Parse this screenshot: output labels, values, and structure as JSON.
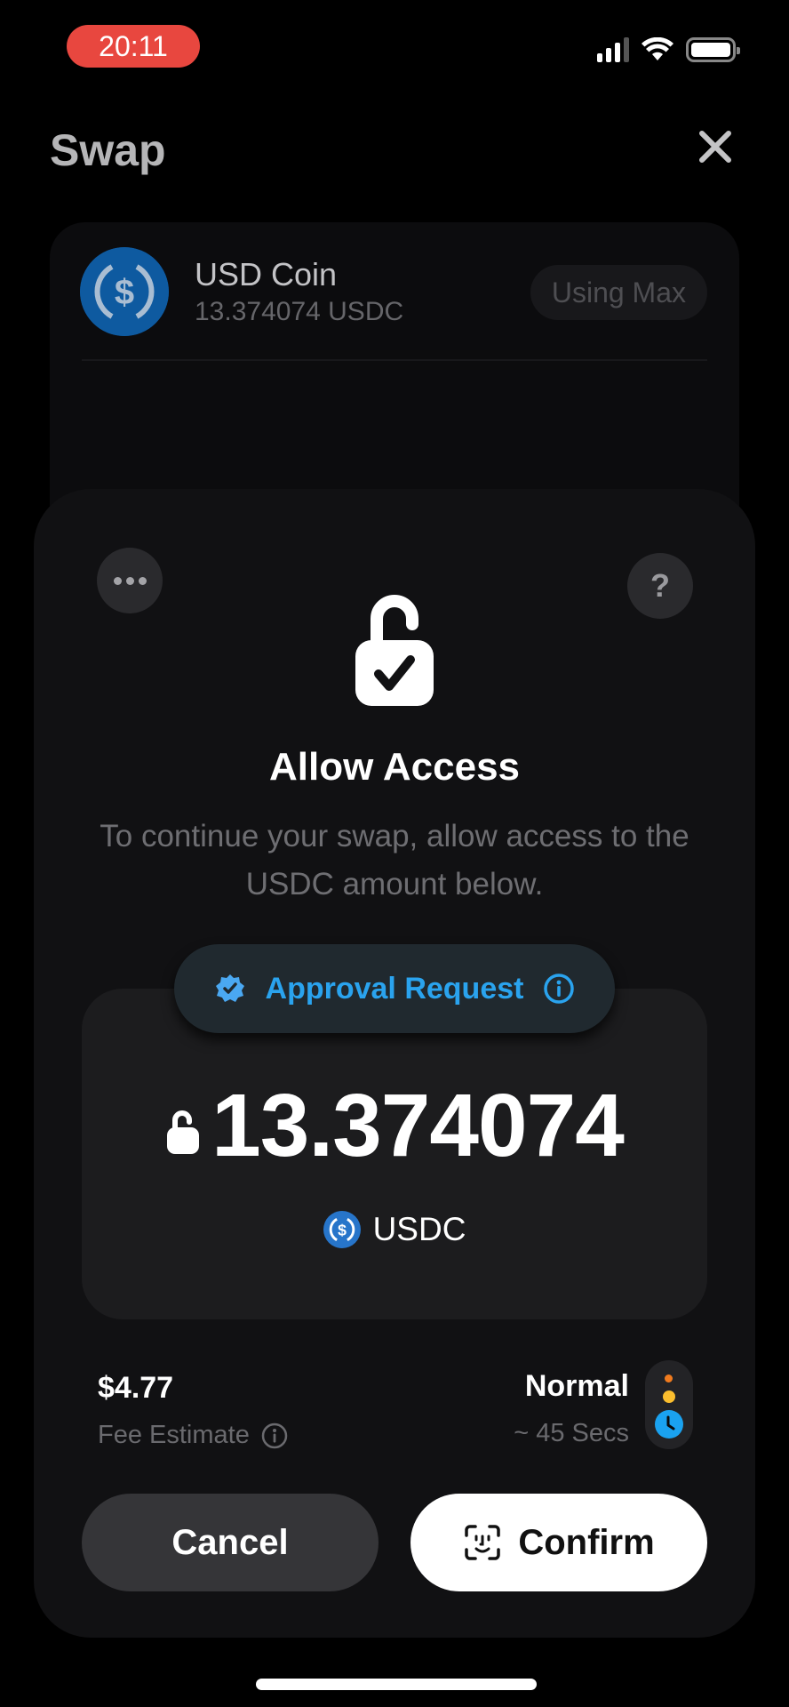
{
  "status_bar": {
    "time": "20:11",
    "icons": [
      "signal-icon",
      "wifi-icon",
      "battery-icon"
    ]
  },
  "header": {
    "title": "Swap",
    "close_icon": "close-icon"
  },
  "source_token": {
    "name": "USD Coin",
    "balance": "13.374074 USDC",
    "max_button": "Using Max",
    "logo_icon": "usdc-icon"
  },
  "sheet": {
    "more_icon": "more-icon",
    "help_label": "?",
    "hero_icon": "unlock-check-icon",
    "title": "Allow Access",
    "description": "To continue your swap, allow access to the USDC amount below.",
    "approval_pill": {
      "label": "Approval Request",
      "badge_icon": "verified-badge-icon",
      "info_icon": "info-icon"
    },
    "amount": {
      "value": "13.374074",
      "token": "USDC",
      "lock_icon": "unlock-icon"
    },
    "fee": {
      "value": "$4.77",
      "label": "Fee Estimate"
    },
    "speed": {
      "label": "Normal",
      "time": "~ 45 Secs"
    },
    "buttons": {
      "cancel": "Cancel",
      "confirm": "Confirm"
    }
  },
  "colors": {
    "accent_blue": "#2aa3ee",
    "usdc_blue": "#2775ca",
    "status_red": "#e8473f",
    "speed_orange": "#f07b1e",
    "speed_yellow": "#fbbe2e"
  }
}
